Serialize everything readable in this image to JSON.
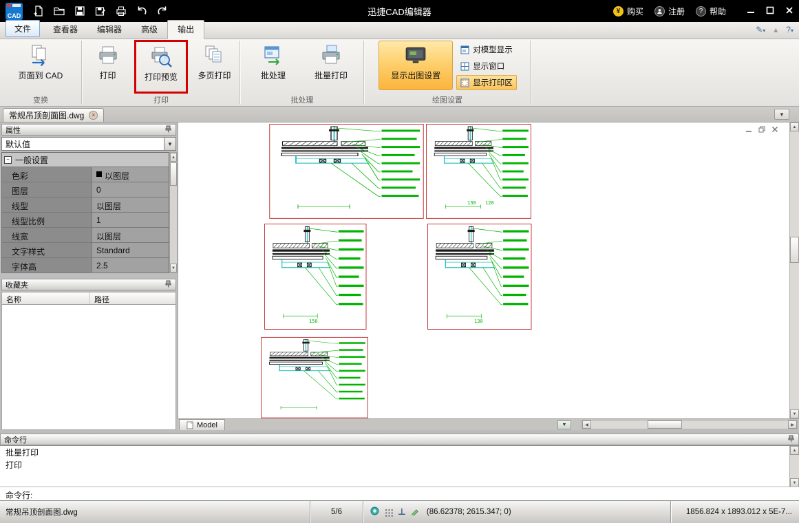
{
  "titlebar": {
    "app_title": "迅捷CAD编辑器",
    "buy": "购买",
    "register": "注册",
    "help": "帮助"
  },
  "tabs": {
    "file": "文件",
    "viewer": "查看器",
    "editor": "编辑器",
    "advanced": "高级",
    "output": "输出"
  },
  "ribbon": {
    "page_to_cad": "页面到 CAD",
    "group_transform": "变换",
    "print": "打印",
    "print_preview": "打印预览",
    "multi_page_print": "多页打印",
    "group_print": "打印",
    "batch_process": "批处理",
    "batch_print": "批量打印",
    "group_batch": "批处理",
    "plot_settings": "显示出图设置",
    "model_display": "对模型显示",
    "display_window": "显示窗口",
    "display_print_area": "显示打印区",
    "group_drawing": "绘图设置"
  },
  "doc_tab": {
    "title": "常规吊顶剖面图.dwg"
  },
  "properties": {
    "title": "属性",
    "preset": "默认值",
    "group": "一般设置",
    "rows": [
      {
        "label": "色彩",
        "value": "以图层"
      },
      {
        "label": "图层",
        "value": "0"
      },
      {
        "label": "线型",
        "value": "以图层"
      },
      {
        "label": "线型比例",
        "value": "1"
      },
      {
        "label": "线宽",
        "value": "以图层"
      },
      {
        "label": "文字样式",
        "value": "Standard"
      },
      {
        "label": "字体高",
        "value": "2.5"
      }
    ]
  },
  "favorites": {
    "title": "收藏夹",
    "col_name": "名称",
    "col_path": "路径"
  },
  "canvas": {
    "model_tab": "Model",
    "dims": [
      "130",
      "120",
      "150",
      "130"
    ]
  },
  "command": {
    "title": "命令行",
    "line1": "批量打印",
    "line2": "打印",
    "prompt": "命令行:"
  },
  "statusbar": {
    "filename": "常规吊顶剖面图.dwg",
    "sheet": "5/6",
    "coords": "(86.62378; 2615.347; 0)",
    "size": "1856.824 x 1893.012 x 5E-7..."
  },
  "colors": {
    "highlight_red": "#d40000",
    "selection_orange": "#fcc96a",
    "cad_green": "#00b400",
    "cad_cyan": "#00b9b9",
    "cad_red": "#c43b3b",
    "titlebar_black": "#000000"
  }
}
